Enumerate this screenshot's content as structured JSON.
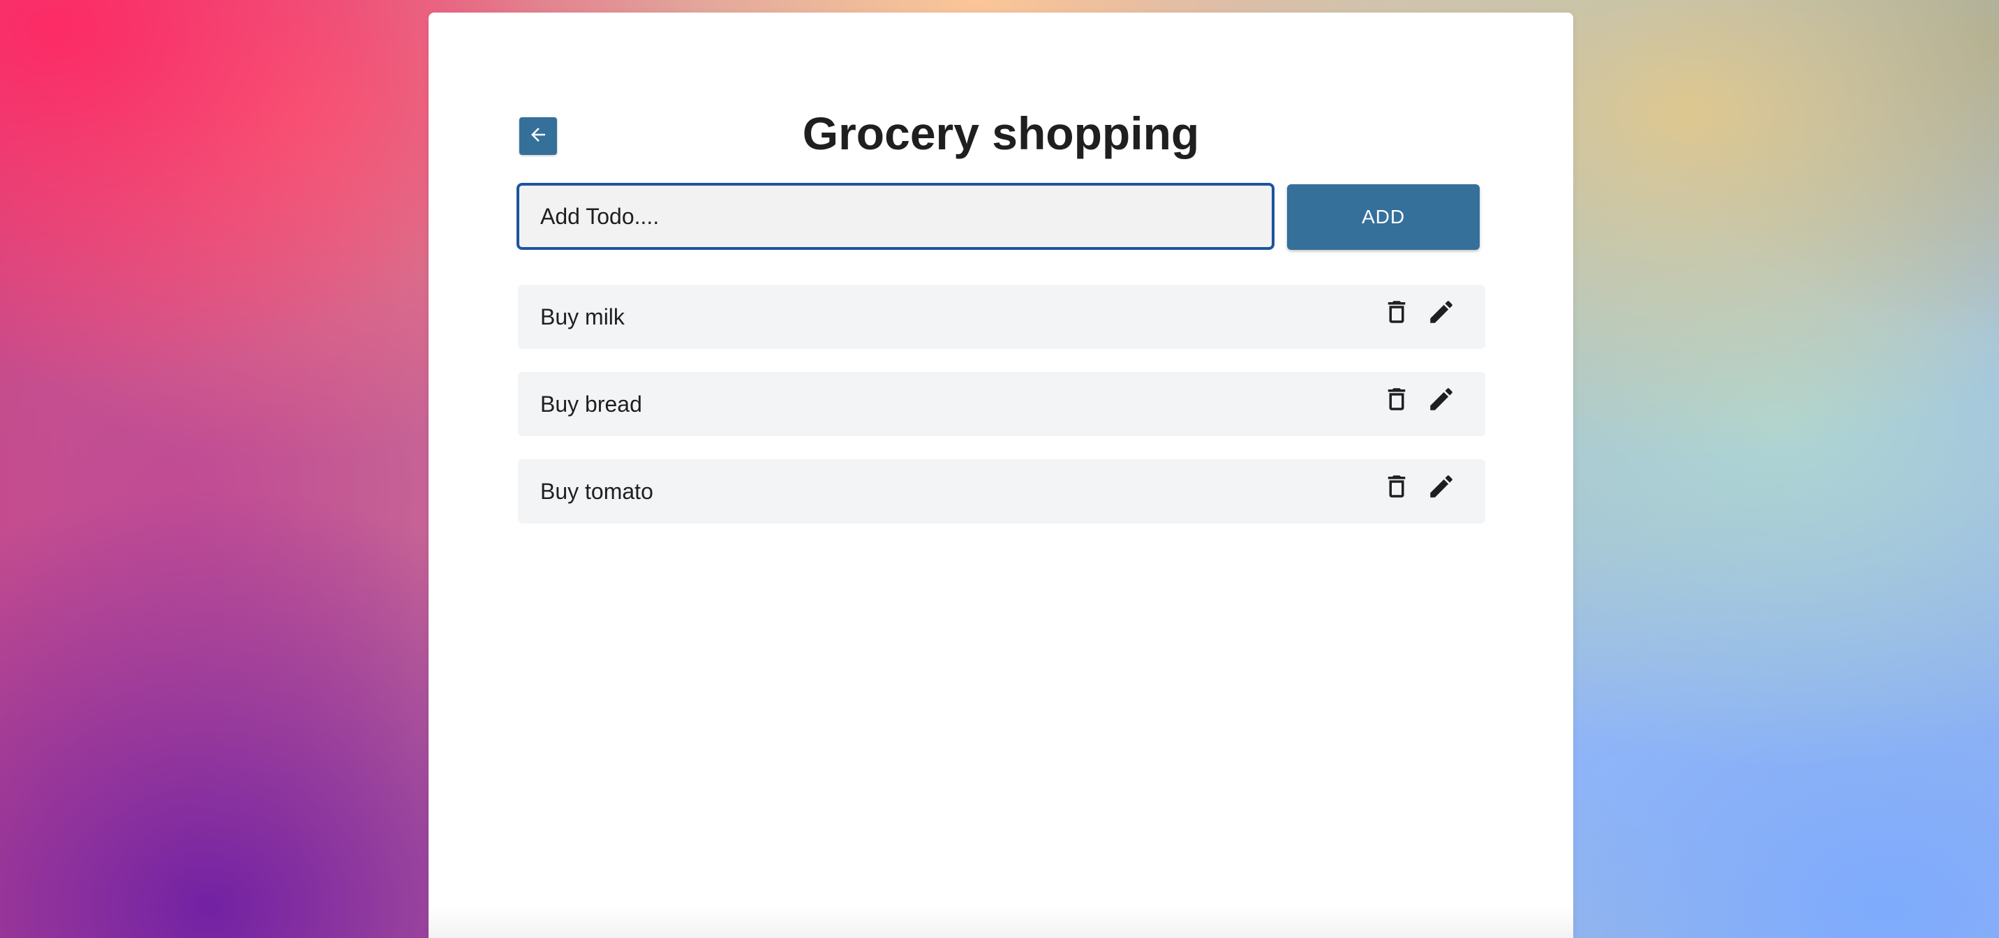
{
  "page": {
    "title": "Grocery shopping"
  },
  "toolbar": {
    "back_icon": "arrow-left-icon"
  },
  "input": {
    "placeholder": "Add Todo....",
    "value": ""
  },
  "add_button": {
    "label": "ADD"
  },
  "todos": [
    {
      "text": "Buy milk",
      "delete_icon": "trash-icon",
      "edit_icon": "pencil-icon"
    },
    {
      "text": "Buy bread",
      "delete_icon": "trash-icon",
      "edit_icon": "pencil-icon"
    },
    {
      "text": "Buy tomato",
      "delete_icon": "trash-icon",
      "edit_icon": "pencil-icon"
    }
  ],
  "colors": {
    "accent": "#35709b",
    "input_border": "#1c55a0",
    "item_background": "#f3f4f6",
    "text": "#1f1f1f"
  }
}
